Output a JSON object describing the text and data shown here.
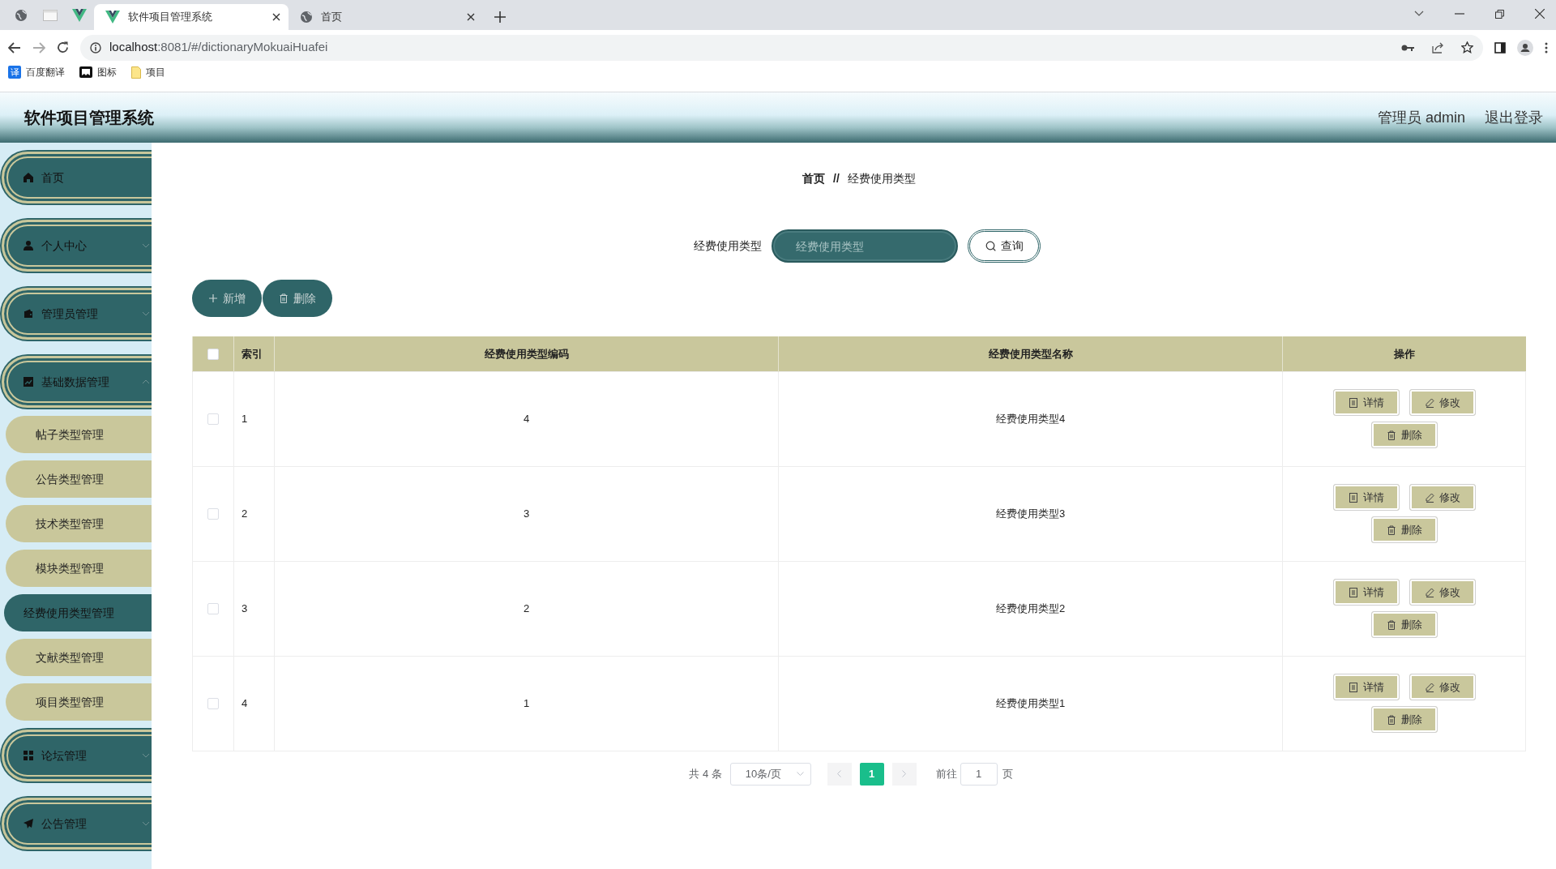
{
  "browser": {
    "tabs": [
      {
        "title": "软件项目管理系统",
        "kind": "vue",
        "selected": true
      },
      {
        "title": "首页",
        "kind": "globe",
        "selected": false
      }
    ],
    "url_host": "localhost",
    "url_rest": ":8081/#/dictionaryMokuaiHuafei",
    "bookmarks": [
      {
        "label": "百度翻译",
        "kind": "translate",
        "glyph": "译"
      },
      {
        "label": "图标",
        "kind": "flag"
      },
      {
        "label": "项目",
        "kind": "folder"
      }
    ]
  },
  "header": {
    "title": "软件项目管理系统",
    "user": "管理员 admin",
    "logout": "退出登录"
  },
  "sidebar": {
    "items": [
      {
        "label": "首页",
        "kind": "home"
      },
      {
        "label": "个人中心",
        "kind": "user",
        "expanded": false
      },
      {
        "label": "管理员管理",
        "kind": "wallet",
        "expanded": false
      },
      {
        "label": "基础数据管理",
        "kind": "chart",
        "expanded": true,
        "children": [
          {
            "label": "帖子类型管理",
            "selected": false
          },
          {
            "label": "公告类型管理",
            "selected": false
          },
          {
            "label": "技术类型管理",
            "selected": false
          },
          {
            "label": "模块类型管理",
            "selected": false
          },
          {
            "label": "经费使用类型管理",
            "selected": true
          },
          {
            "label": "文献类型管理",
            "selected": false
          },
          {
            "label": "项目类型管理",
            "selected": false
          }
        ]
      },
      {
        "label": "论坛管理",
        "kind": "grid",
        "expanded": false
      },
      {
        "label": "公告管理",
        "kind": "plane",
        "expanded": false
      }
    ]
  },
  "breadcrumb": [
    "首页",
    "经费使用类型"
  ],
  "breadcrumb_separator": "//",
  "search": {
    "label": "经费使用类型",
    "placeholder": "经费使用类型",
    "button": "查询"
  },
  "actions": [
    {
      "label": "新增",
      "kind": "add"
    },
    {
      "label": "删除",
      "kind": "delete"
    }
  ],
  "table": {
    "header_checked": false,
    "columns": [
      "索引",
      "经费使用类型编码",
      "经费使用类型名称",
      "操作"
    ],
    "rows": [
      {
        "checked": false,
        "index": "1",
        "code": "4",
        "name": "经费使用类型4",
        "actions": [
          {
            "label": "详情",
            "kind": "detail"
          },
          {
            "label": "修改",
            "kind": "edit"
          },
          {
            "label": "删除",
            "kind": "delete"
          }
        ]
      },
      {
        "checked": false,
        "index": "2",
        "code": "3",
        "name": "经费使用类型3",
        "actions": [
          {
            "label": "详情",
            "kind": "detail"
          },
          {
            "label": "修改",
            "kind": "edit"
          },
          {
            "label": "删除",
            "kind": "delete"
          }
        ]
      },
      {
        "checked": false,
        "index": "3",
        "code": "2",
        "name": "经费使用类型2",
        "actions": [
          {
            "label": "详情",
            "kind": "detail"
          },
          {
            "label": "修改",
            "kind": "edit"
          },
          {
            "label": "删除",
            "kind": "delete"
          }
        ]
      },
      {
        "checked": false,
        "index": "4",
        "code": "1",
        "name": "经费使用类型1",
        "actions": [
          {
            "label": "详情",
            "kind": "detail"
          },
          {
            "label": "修改",
            "kind": "edit"
          },
          {
            "label": "删除",
            "kind": "delete"
          }
        ]
      }
    ]
  },
  "pagination": {
    "total": "共 4 条",
    "page_size": "10条/页",
    "pages": [
      {
        "label": "1",
        "selected": true
      }
    ],
    "goto_label": "前往",
    "goto_value": "1",
    "page_unit": "页"
  }
}
